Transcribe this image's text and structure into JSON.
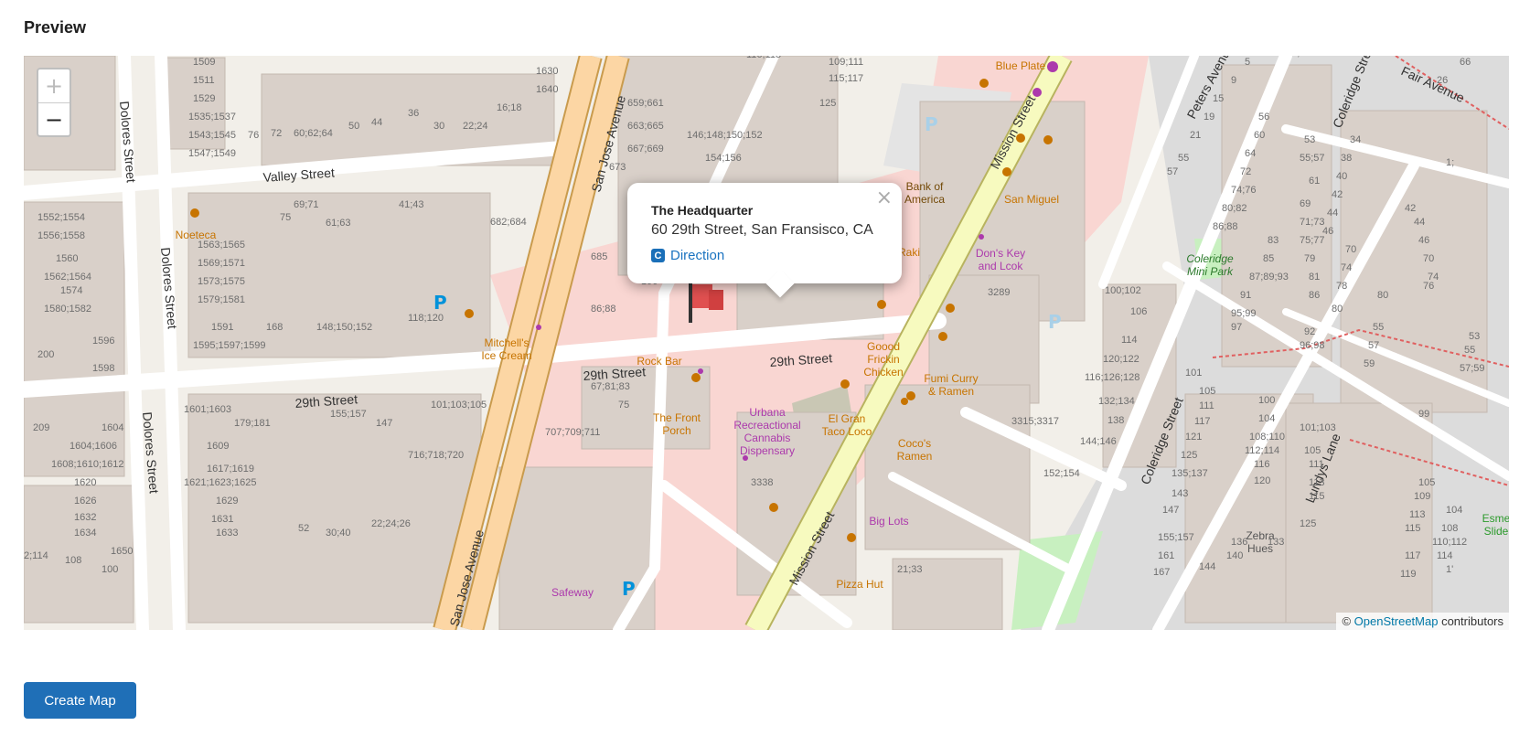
{
  "section_title": "Preview",
  "map": {
    "zoom_in": "+",
    "zoom_out": "−",
    "attribution_prefix": "©",
    "attribution_link": "OpenStreetMap",
    "attribution_suffix": "contributors",
    "streets": {
      "dolores": "Dolores Street",
      "valley": "Valley Street",
      "san_jose": "San Jose Avenue",
      "twenty_ninth": "29th Street",
      "mission": "Mission Street",
      "peters": "Peters Avenue",
      "coleridge": "Coleridge Street",
      "fair": "Fair Avenue",
      "lundys": "Lundys Lane"
    },
    "pois": {
      "noeteca": "Noeteca",
      "mitchells": "Mitchell's Ice Cream",
      "rock_bar": "Rock Bar",
      "front_porch": "The Front Porch",
      "urbana": "Urbana Recreactional Cannabis Dispensary",
      "el_gran": "El Gran Taco Loco",
      "cocos": "Coco's Ramen",
      "big_lots": "Big Lots",
      "safeway": "Safeway",
      "pizza_hut": "Pizza Hut",
      "goood": "Goood Frickin Chicken",
      "fumi": "Fumi Curry & Ramen",
      "dons": "Don's Key and Lcok",
      "san_miguel": "San Miguel",
      "bank": "Bank of America",
      "blue_plate": "Blue Plate",
      "coleridge_park": "Coleridge Mini Park",
      "zebra": "Zebra Hues",
      "raki": "Raki",
      "esme": "Esme Slide"
    },
    "popup": {
      "name": "The Headquarter",
      "address": "60 29th Street, San Fransisco, CA",
      "direction_label": "Direction",
      "close": "×"
    }
  },
  "create_button": "Create Map"
}
